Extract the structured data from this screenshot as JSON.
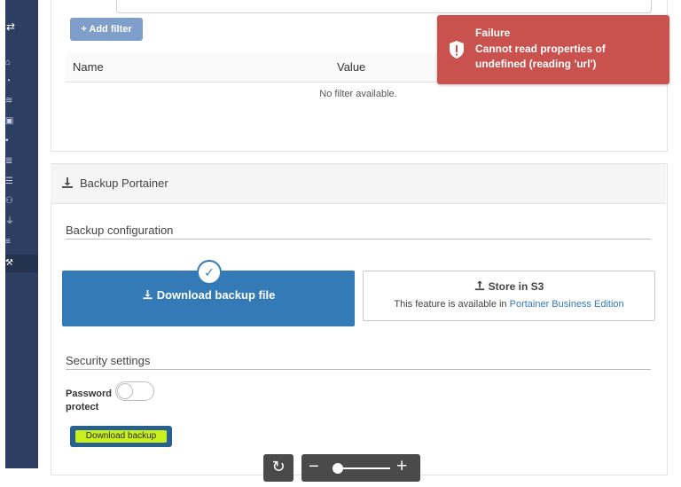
{
  "filters": {
    "add_filter_label": "+ Add filter",
    "columns": [
      "Name",
      "Value"
    ],
    "empty_text": "No filter available."
  },
  "toast": {
    "title": "Failure",
    "message": "Cannot read properties of undefined (reading 'url')",
    "icon": "shield-exclamation-icon",
    "color": "#c9524e"
  },
  "backup": {
    "section_title": "Backup Portainer",
    "config_title": "Backup configuration",
    "options": {
      "download": {
        "label": "Download backup file",
        "selected": true
      },
      "s3": {
        "label": "Store in S3",
        "desc_prefix": "This feature is available in ",
        "desc_link": "Portainer Business Edition"
      }
    },
    "security_title": "Security settings",
    "password_protect_label": "Password protect",
    "password_protect_enabled": false,
    "download_button": "Download backup"
  },
  "viewer": {
    "reset_icon": "rotate-icon",
    "zoom_level": 0
  },
  "sidebar": {
    "icons": [
      "swap-icon",
      "home-icon",
      "dashboard-icon",
      "layers-icon",
      "desktop-icon",
      "box-icon",
      "stack-icon",
      "list-icon",
      "users-icon",
      "plug-icon",
      "database-icon",
      "settings-icon"
    ]
  },
  "colors": {
    "sidebar": "#2d3e63",
    "primary": "#337ab7",
    "danger": "#c9524e",
    "highlight": "#c8f01e"
  }
}
